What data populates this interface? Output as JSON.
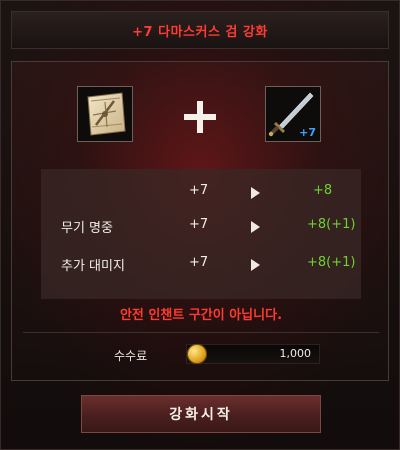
{
  "window": {
    "title": "+7 다마스커스 검 강화"
  },
  "materials": {
    "scroll_icon": "enhancement-scroll-icon",
    "plus_icon": "plus-icon",
    "sword_icon": "damascus-sword-icon",
    "sword_level": "+7"
  },
  "stats": {
    "level_row": {
      "label": "",
      "current": "+7",
      "next": "+8"
    },
    "rows": [
      {
        "label": "무기 명중",
        "current": "+7",
        "next": "+8(+1)"
      },
      {
        "label": "추가 대미지",
        "current": "+7",
        "next": "+8(+1)"
      }
    ]
  },
  "warning_text": "안전 인챈트 구간이 아닙니다.",
  "fee": {
    "label": "수수료",
    "icon": "gold-coin-icon",
    "value": "1,000"
  },
  "start_button": {
    "label": "강화시작"
  },
  "colors": {
    "title_red": "#ff3b33",
    "next_green": "#6ed233",
    "warning_red": "#ff3a2f",
    "sword_level_blue": "#3fa1ff"
  }
}
